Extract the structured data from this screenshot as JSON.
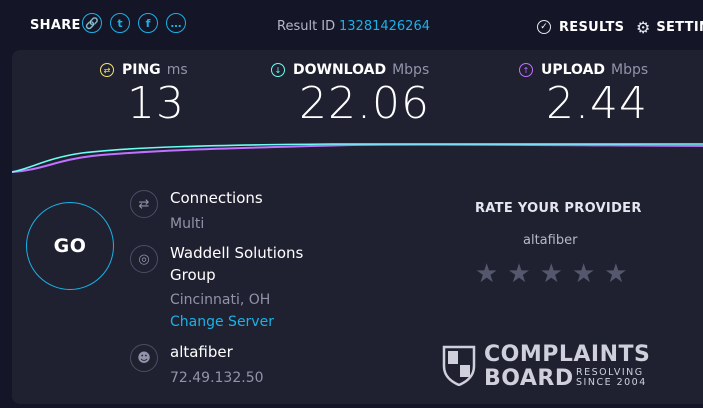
{
  "topbar": {
    "share_label": "SHARE",
    "social_icons": [
      "link-icon",
      "twitter-icon",
      "facebook-icon",
      "more-icon"
    ],
    "result_label": "Result ID",
    "result_id": "13281426264",
    "results_label": "RESULTS",
    "settings_label": "SETTINGS"
  },
  "metrics": {
    "ping": {
      "label": "PING",
      "unit": "ms",
      "value": "13",
      "color": "#f2e56b"
    },
    "download": {
      "label": "DOWNLOAD",
      "unit": "Mbps",
      "value": "22.06",
      "color": "#6afff3"
    },
    "upload": {
      "label": "UPLOAD",
      "unit": "Mbps",
      "value": "2.44",
      "color": "#bf71ff"
    }
  },
  "go_label": "GO",
  "connections": {
    "label": "Connections",
    "value": "Multi"
  },
  "server": {
    "name": "Waddell Solutions Group",
    "name_line1": "Waddell Solutions",
    "name_line2": "Group",
    "location": "Cincinnati, OH",
    "change_label": "Change Server"
  },
  "host": {
    "isp": "altafiber",
    "ip": "72.49.132.50"
  },
  "rate": {
    "title": "RATE YOUR PROVIDER",
    "provider": "altafiber",
    "stars": 0,
    "max_stars": 5
  },
  "watermark": {
    "line1": "COMPLAINTS",
    "line2": "BOARD",
    "tag1": "RESOLVING",
    "tag2": "SINCE 2004"
  },
  "colors": {
    "accent": "#1bb1e6",
    "background": "#141526",
    "panel": "#1f2131"
  }
}
